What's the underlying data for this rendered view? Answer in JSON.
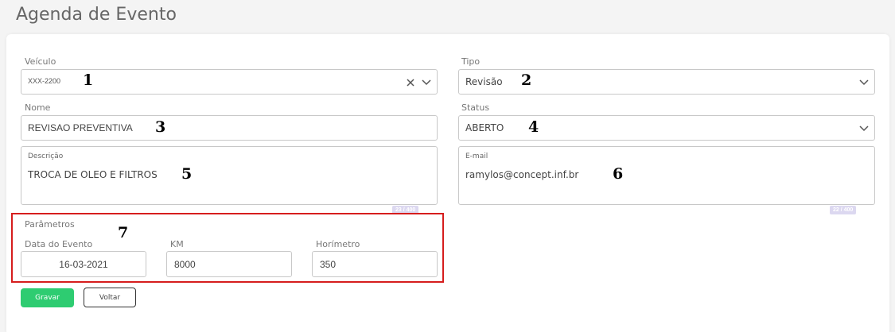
{
  "header": {
    "title": "Agenda de Evento"
  },
  "form": {
    "veiculo": {
      "label": "Veículo",
      "value": "XXX-2200",
      "marker": "1"
    },
    "tipo": {
      "label": "Tipo",
      "value": "Revisão",
      "marker": "2"
    },
    "nome": {
      "label": "Nome",
      "value": "REVISAO PREVENTIVA",
      "marker": "3"
    },
    "status": {
      "label": "Status",
      "value": "ABERTO",
      "marker": "4"
    },
    "descricao": {
      "label": "Descrição",
      "value": "TROCA DE OLEO E FILTROS",
      "counter": "23 / 400",
      "marker": "5"
    },
    "email": {
      "label": "E-mail",
      "value": "ramylos@concept.inf.br",
      "counter": "22 / 400",
      "marker": "6"
    },
    "parametros": {
      "label": "Parâmetros",
      "marker": "7",
      "data_evento": {
        "label": "Data do Evento",
        "value": "16-03-2021"
      },
      "km": {
        "label": "KM",
        "value": "8000"
      },
      "horimetro": {
        "label": "Horímetro",
        "value": "350"
      }
    }
  },
  "actions": {
    "save_label": "Gravar",
    "back_label": "Voltar"
  },
  "icons": {
    "clear": "close-icon",
    "dropdown": "chevron-down-icon"
  },
  "colors": {
    "primary_button": "#2ecc71",
    "highlight_border": "#d61d1d"
  }
}
